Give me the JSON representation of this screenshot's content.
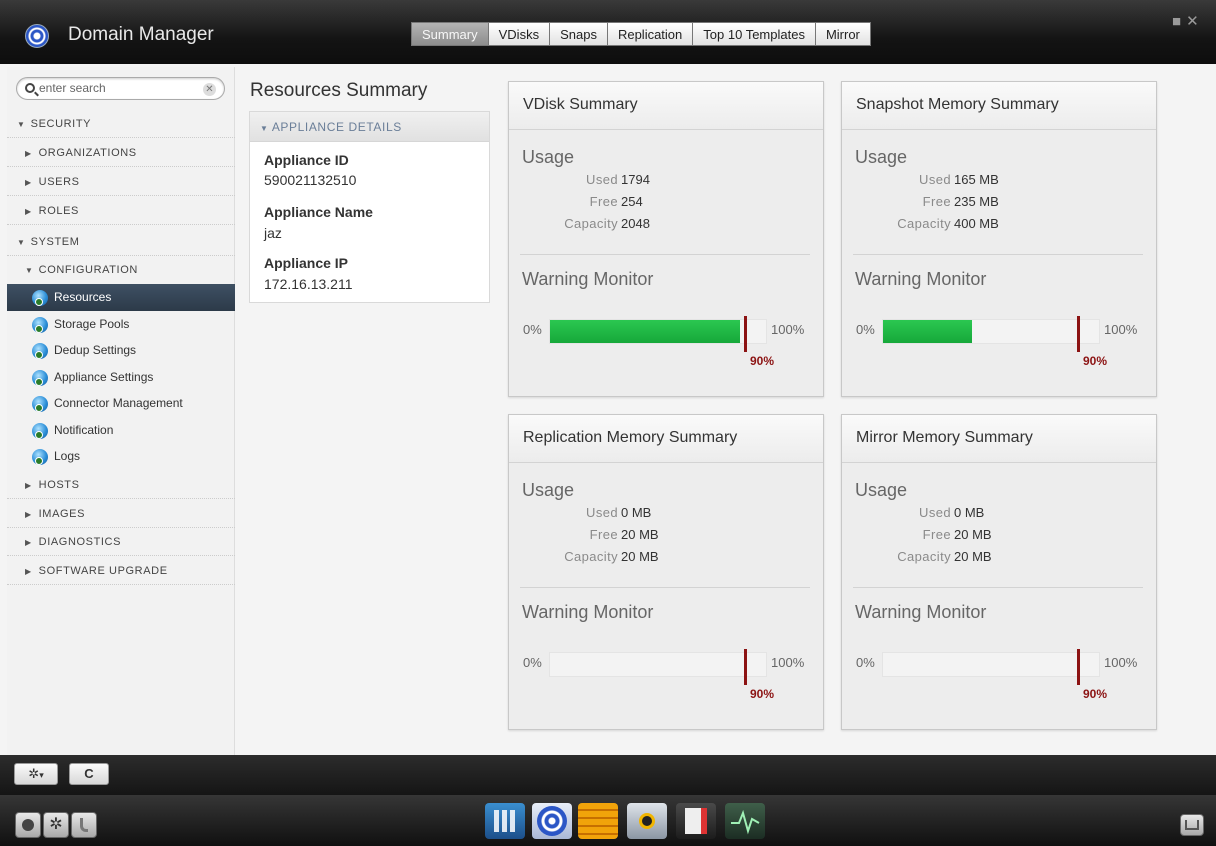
{
  "app": {
    "title": "Domain Manager"
  },
  "tabs": [
    {
      "label": "Summary",
      "active": true
    },
    {
      "label": "VDisks"
    },
    {
      "label": "Snaps"
    },
    {
      "label": "Replication"
    },
    {
      "label": "Top 10 Templates"
    },
    {
      "label": "Mirror"
    }
  ],
  "search": {
    "placeholder": "enter search"
  },
  "sidebar": {
    "security": "SECURITY",
    "organizations": "ORGANIZATIONS",
    "users": "USERS",
    "roles": "ROLES",
    "system": "SYSTEM",
    "configuration": "CONFIGURATION",
    "config_items": [
      "Resources",
      "Storage Pools",
      "Dedup Settings",
      "Appliance Settings",
      "Connector Management",
      "Notification",
      "Logs"
    ],
    "hosts": "HOSTS",
    "images": "IMAGES",
    "diagnostics": "DIAGNOSTICS",
    "software_upgrade": "SOFTWARE UPGRADE"
  },
  "main": {
    "title": "Resources Summary",
    "appliance": {
      "header": "APPLIANCE DETAILS",
      "id_label": "Appliance ID",
      "id_value": "590021132510",
      "name_label": "Appliance Name",
      "name_value": "jaz",
      "ip_label": "Appliance IP",
      "ip_value": "172.16.13.211"
    }
  },
  "labels": {
    "usage": "Usage",
    "used": "Used",
    "free": "Free",
    "capacity": "Capacity",
    "warning": "Warning Monitor",
    "min": "0%",
    "max": "100%",
    "threshold": "90%"
  },
  "cards": [
    {
      "title": "VDisk Summary",
      "used": "1794",
      "free": "254",
      "capacity": "2048",
      "usage_fraction": 0.88
    },
    {
      "title": "Snapshot Memory Summary",
      "used": "165 MB",
      "free": "235 MB",
      "capacity": "400 MB",
      "usage_fraction": 0.41
    },
    {
      "title": "Replication Memory Summary",
      "used": "0 MB",
      "free": "20 MB",
      "capacity": "20 MB",
      "usage_fraction": 0
    },
    {
      "title": "Mirror Memory Summary",
      "used": "0 MB",
      "free": "20 MB",
      "capacity": "20 MB",
      "usage_fraction": 0
    }
  ],
  "toolbar": {
    "refresh_label": "C"
  }
}
